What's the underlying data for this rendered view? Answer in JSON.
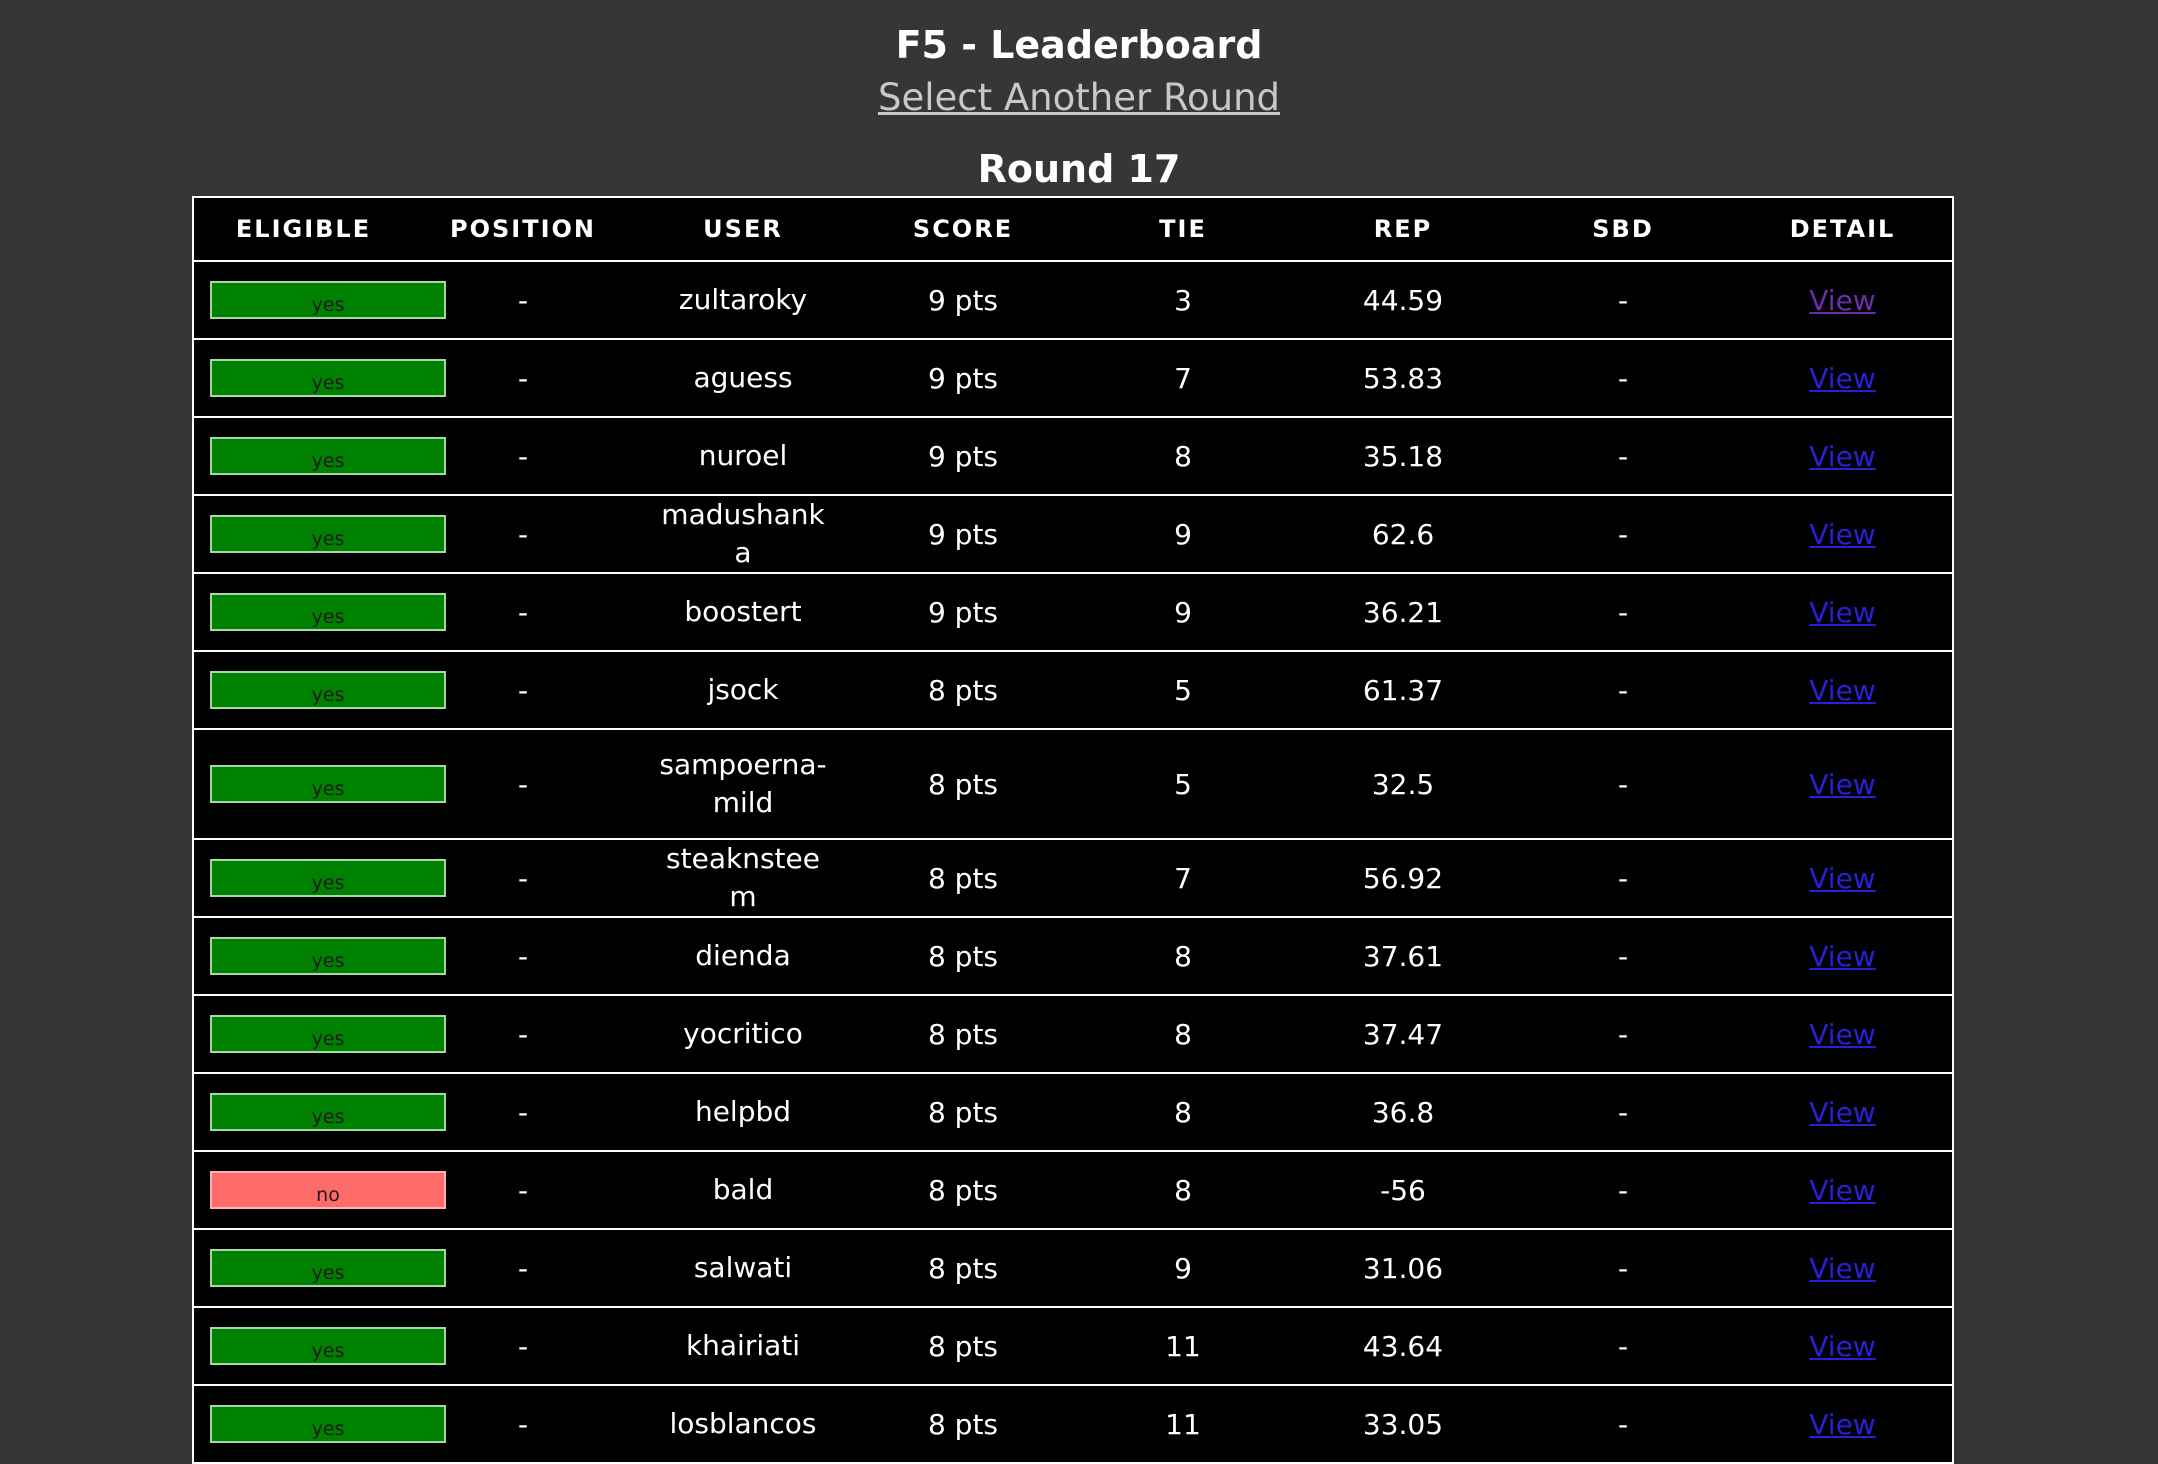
{
  "header": {
    "title": "F5 - Leaderboard",
    "select_round_link": "Select Another Round",
    "round_title": "Round 17"
  },
  "table": {
    "columns": [
      "ELIGIBLE",
      "POSITION",
      "USER",
      "SCORE",
      "TIE",
      "REP",
      "SBD",
      "DETAIL"
    ],
    "rows": [
      {
        "eligible": "yes",
        "position": "-",
        "user": "zultaroky",
        "score": "9 pts",
        "tie": "3",
        "rep": "44.59",
        "sbd": "-",
        "detail": "View"
      },
      {
        "eligible": "yes",
        "position": "-",
        "user": "aguess",
        "score": "9 pts",
        "tie": "7",
        "rep": "53.83",
        "sbd": "-",
        "detail": "View"
      },
      {
        "eligible": "yes",
        "position": "-",
        "user": "nuroel",
        "score": "9 pts",
        "tie": "8",
        "rep": "35.18",
        "sbd": "-",
        "detail": "View"
      },
      {
        "eligible": "yes",
        "position": "-",
        "user": "madushanka",
        "score": "9 pts",
        "tie": "9",
        "rep": "62.6",
        "sbd": "-",
        "detail": "View"
      },
      {
        "eligible": "yes",
        "position": "-",
        "user": "boostert",
        "score": "9 pts",
        "tie": "9",
        "rep": "36.21",
        "sbd": "-",
        "detail": "View"
      },
      {
        "eligible": "yes",
        "position": "-",
        "user": "jsock",
        "score": "8 pts",
        "tie": "5",
        "rep": "61.37",
        "sbd": "-",
        "detail": "View"
      },
      {
        "eligible": "yes",
        "position": "-",
        "user": "sampoerna-mild",
        "score": "8 pts",
        "tie": "5",
        "rep": "32.5",
        "sbd": "-",
        "detail": "View"
      },
      {
        "eligible": "yes",
        "position": "-",
        "user": "steaknsteem",
        "score": "8 pts",
        "tie": "7",
        "rep": "56.92",
        "sbd": "-",
        "detail": "View"
      },
      {
        "eligible": "yes",
        "position": "-",
        "user": "dienda",
        "score": "8 pts",
        "tie": "8",
        "rep": "37.61",
        "sbd": "-",
        "detail": "View"
      },
      {
        "eligible": "yes",
        "position": "-",
        "user": "yocritico",
        "score": "8 pts",
        "tie": "8",
        "rep": "37.47",
        "sbd": "-",
        "detail": "View"
      },
      {
        "eligible": "yes",
        "position": "-",
        "user": "helpbd",
        "score": "8 pts",
        "tie": "8",
        "rep": "36.8",
        "sbd": "-",
        "detail": "View"
      },
      {
        "eligible": "no",
        "position": "-",
        "user": "bald",
        "score": "8 pts",
        "tie": "8",
        "rep": "-56",
        "sbd": "-",
        "detail": "View"
      },
      {
        "eligible": "yes",
        "position": "-",
        "user": "salwati",
        "score": "8 pts",
        "tie": "9",
        "rep": "31.06",
        "sbd": "-",
        "detail": "View"
      },
      {
        "eligible": "yes",
        "position": "-",
        "user": "khairiati",
        "score": "8 pts",
        "tie": "11",
        "rep": "43.64",
        "sbd": "-",
        "detail": "View"
      },
      {
        "eligible": "yes",
        "position": "-",
        "user": "losblancos",
        "score": "8 pts",
        "tie": "11",
        "rep": "33.05",
        "sbd": "-",
        "detail": "View"
      }
    ]
  },
  "colors": {
    "background": "#363636",
    "table_background": "#000000",
    "eligible_yes": "#008000",
    "eligible_no": "#ff6b6b",
    "link": "#2a1fd6",
    "link_visited": "#6a2fa8"
  }
}
